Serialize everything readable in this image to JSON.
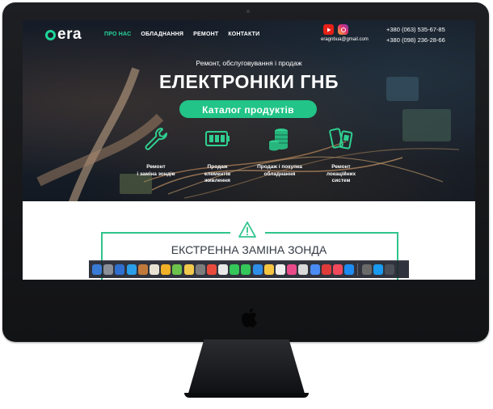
{
  "nav": {
    "logo": "era",
    "items": [
      {
        "label": "ПРО НАС",
        "active": true
      },
      {
        "label": "ОБЛАДНАННЯ",
        "active": false
      },
      {
        "label": "РЕМОНТ",
        "active": false
      },
      {
        "label": "КОНТАКТИ",
        "active": false
      }
    ]
  },
  "contacts": {
    "email": "eragnbua@gmail.com",
    "phone1": "+380 (063) 535-67-85",
    "phone2": "+380 (098) 236-28-66"
  },
  "hero": {
    "subtitle": "Ремонт, обслуговування і продаж",
    "title": "ЕЛЕКТРОНІКИ ГНБ",
    "cta": "Каталог продуктів"
  },
  "services": [
    {
      "icon": "wrench-icon",
      "label": "Ремонт\nі заміна зондів"
    },
    {
      "icon": "battery-icon",
      "label": "Продаж\nелементів\nживлення"
    },
    {
      "icon": "coins-icon",
      "label": "Продаж і покупка\nобладнання"
    },
    {
      "icon": "device-icon",
      "label": "Ремонт\nлокаційних\nсистем"
    }
  ],
  "section": {
    "heading": "ЕКСТРЕННА ЗАМІНА ЗОНДА"
  },
  "colors": {
    "accent": "#22c487",
    "nav_active": "#27d79b"
  },
  "dock": [
    "#3a7bd5",
    "#8a8f98",
    "#2f6fd0",
    "#2a9ee8",
    "#c27a3c",
    "#e7e2d3",
    "#f0b028",
    "#6dc24b",
    "#f2c94c",
    "#7d7d7d",
    "#e94b3c",
    "#e8e8e8",
    "#35c759",
    "#34c759",
    "#2f8ee8",
    "#f5c542",
    "#eeeeee",
    "#e94b8a",
    "#d9d9d9",
    "#4b8bf5",
    "#e03b3b",
    "#f04a5c",
    "#1e8cf0",
    "#6a6a6a",
    "#1a9af0",
    "#4a4f58"
  ]
}
